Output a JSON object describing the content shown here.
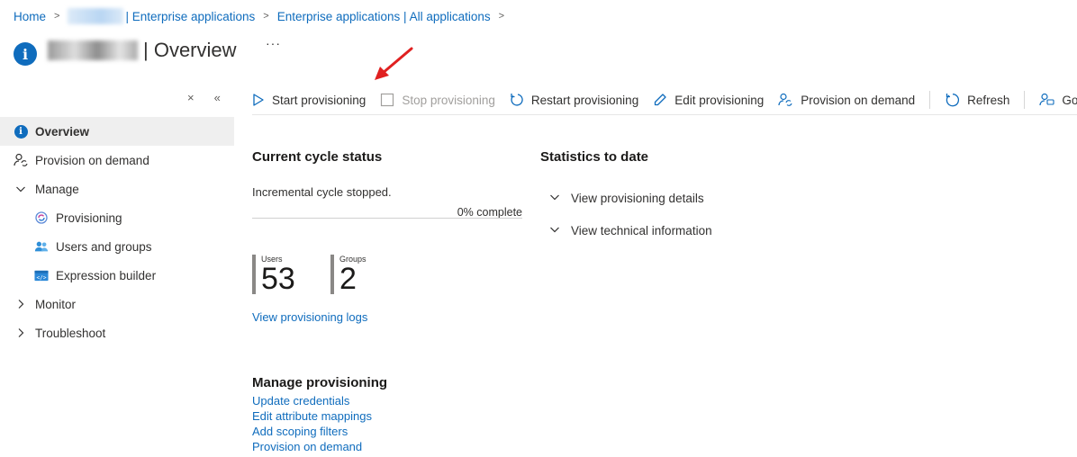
{
  "breadcrumb": {
    "home": "Home",
    "enterprise": "| Enterprise applications",
    "all_apps": "Enterprise applications | All applications"
  },
  "header": {
    "title_visible": "| Overview",
    "more": "···"
  },
  "sidebar": {
    "close_glyph": "×",
    "collapse_glyph": "«",
    "items": [
      {
        "label": "Overview",
        "icon": "info-icon"
      },
      {
        "label": "Provision on demand",
        "icon": "person-sync-icon"
      },
      {
        "label": "Manage",
        "icon": "chevron-down-icon"
      },
      {
        "label": "Provisioning",
        "icon": "provisioning-icon"
      },
      {
        "label": "Users and groups",
        "icon": "users-icon"
      },
      {
        "label": "Expression builder",
        "icon": "expression-icon"
      },
      {
        "label": "Monitor",
        "icon": "chevron-right-icon"
      },
      {
        "label": "Troubleshoot",
        "icon": "chevron-right-icon"
      }
    ]
  },
  "toolbar": {
    "start": "Start provisioning",
    "stop": "Stop provisioning",
    "restart": "Restart provisioning",
    "edit": "Edit provisioning",
    "on_demand": "Provision on demand",
    "refresh": "Refresh",
    "feedback": "Got fe"
  },
  "cycle": {
    "heading": "Current cycle status",
    "status": "Incremental cycle stopped.",
    "progress_label": "0% complete",
    "progress_fraction": 0
  },
  "stats": {
    "users_label": "Users",
    "users_value": "53",
    "groups_label": "Groups",
    "groups_value": "2"
  },
  "links": {
    "view_logs": "View provisioning logs"
  },
  "statistics": {
    "heading": "Statistics to date",
    "details": "View provisioning details",
    "technical": "View technical information"
  },
  "manage_provisioning": {
    "heading": "Manage provisioning",
    "items": [
      "Update credentials",
      "Edit attribute mappings",
      "Add scoping filters",
      "Provision on demand"
    ]
  },
  "colors": {
    "accent": "#0f6cbd",
    "arrow": "#e02020",
    "active_bg": "#efefef"
  }
}
